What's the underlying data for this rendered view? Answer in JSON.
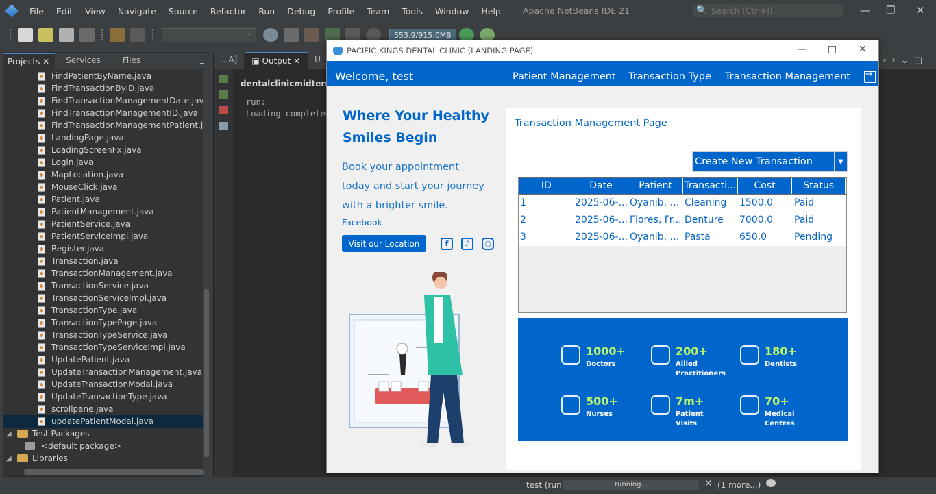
{
  "ide": {
    "title": "Apache NetBeans IDE 21",
    "menu": [
      "File",
      "Edit",
      "View",
      "Navigate",
      "Source",
      "Refactor",
      "Run",
      "Debug",
      "Profile",
      "Team",
      "Tools",
      "Window",
      "Help"
    ],
    "search_placeholder": "Search (Ctrl+I)",
    "memory": "553.9/915.0MB",
    "panel_tabs": [
      "Projects",
      "Services",
      "Files"
    ],
    "tree_files": [
      "FindPatientByName.java",
      "FindTransactionByID.java",
      "FindTransactionManagementDate.java",
      "FindTransactionManagementID.java",
      "FindTransactionManagementPatient.java",
      "LandingPage.java",
      "LoadingScreenFx.java",
      "Login.java",
      "MapLocation.java",
      "MouseClick.java",
      "Patient.java",
      "PatientManagement.java",
      "PatientService.java",
      "PatientServiceImpl.java",
      "Register.java",
      "Transaction.java",
      "TransactionManagement.java",
      "TransactionService.java",
      "TransactionServiceImpl.java",
      "TransactionType.java",
      "TransactionTypePage.java",
      "TransactionTypeService.java",
      "TransactionTypeServiceImpl.java",
      "UpdatePatient.java",
      "UpdateTransactionManagement.java",
      "UpdateTransactionModal.java",
      "UpdateTransactionType.java",
      "scrollpane.java",
      "updatePatientModal.java"
    ],
    "test_packages": "Test Packages",
    "default_package": "<default package>",
    "libraries": "Libraries",
    "output_tabs": [
      "...A]",
      "Output",
      "U"
    ],
    "output_header": "dentalclinicmidterm (r",
    "console": [
      "run:",
      "Loading completed"
    ],
    "status_run": "test (run)",
    "status_progress": "running...",
    "status_more": "(1 more...)"
  },
  "app": {
    "window_title": "PACIFIC KINGS DENTAL CLINIC (LANDING PAGE)",
    "welcome": "Welcome, test",
    "nav": [
      "Patient Management",
      "Transaction Type",
      "Transaction Management"
    ],
    "hero_title": "Where Your Healthy Smiles Begin",
    "hero_text": "Book your appointment today and start your journey with a brighter smile.",
    "facebook": "Facebook",
    "location_button": "Visit our Location",
    "page_title": "Transaction Management Page",
    "create_button": "Create New Transaction",
    "table": {
      "columns": [
        "ID",
        "Date",
        "Patient",
        "Transacti...",
        "Cost",
        "Status"
      ],
      "rows": [
        [
          "1",
          "2025-06-...",
          "Oyanib, P...",
          "Cleaning",
          "1500.0",
          "Paid"
        ],
        [
          "2",
          "2025-06-...",
          "Flores, Fr...",
          "Denture",
          "7000.0",
          "Paid"
        ],
        [
          "3",
          "2025-06-...",
          "Oyanib, P...",
          "Pasta",
          "650.0",
          "Pending"
        ]
      ]
    },
    "stats": [
      {
        "num": "1000+",
        "label": "Doctors",
        "icon": "stethoscope-icon"
      },
      {
        "num": "200+",
        "label": "Allied\nPractitioners",
        "icon": "handshake-icon"
      },
      {
        "num": "180+",
        "label": "Dentists",
        "icon": "tooth-icon"
      },
      {
        "num": "500+",
        "label": "Nurses",
        "icon": "syringe-icon"
      },
      {
        "num": "7m+",
        "label": "Patient\nVisits",
        "icon": "ambulance-icon"
      },
      {
        "num": "70+",
        "label": "Medical\nCentres",
        "icon": "hospital-icon"
      }
    ],
    "colors": {
      "primary": "#0066cc",
      "stat_number": "#b9f36c"
    }
  }
}
